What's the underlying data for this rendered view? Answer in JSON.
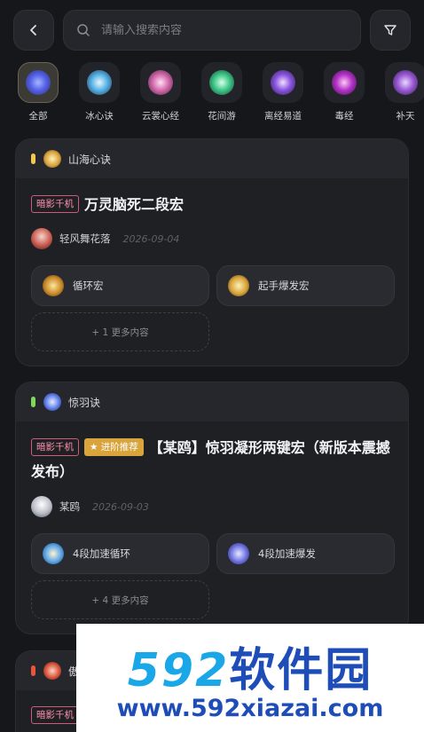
{
  "search": {
    "placeholder": "请输入搜索内容"
  },
  "categories": [
    {
      "label": "全部",
      "icon": "all-swirl-icon",
      "active": true
    },
    {
      "label": "冰心诀",
      "icon": "bingxin-icon"
    },
    {
      "label": "云裳心经",
      "icon": "yunshang-icon"
    },
    {
      "label": "花间游",
      "icon": "huajian-icon"
    },
    {
      "label": "离经易道",
      "icon": "lijing-icon"
    },
    {
      "label": "毒经",
      "icon": "dujing-icon"
    },
    {
      "label": "补天",
      "icon": "butian-icon"
    }
  ],
  "cards": [
    {
      "school": "山海心诀",
      "dot_color": "#f2c94c",
      "tags": [
        "暗影千机"
      ],
      "title": "万灵脑死二段宏",
      "author": "轻风舞花落",
      "date": "2026-09-04",
      "macros": [
        "循环宏",
        "起手爆发宏"
      ],
      "more": "+ 1 更多内容"
    },
    {
      "school": "惊羽诀",
      "dot_color": "#7ed957",
      "tags": [
        "暗影千机"
      ],
      "gold_tag": "进阶推荐",
      "title": "【某鸥】惊羽凝形两键宏（新版本震撼发布）",
      "author": "某鸥",
      "date": "2026-09-03",
      "macros": [
        "4段加速循环",
        "4段加速爆发"
      ],
      "more": "+ 4 更多内容"
    },
    {
      "school": "傲",
      "dot_color": "#e8553b",
      "tags": [
        "暗影千机"
      ]
    }
  ],
  "watermark": {
    "number": "592",
    "name": "软件园",
    "url": "www.592xiazai.com"
  }
}
